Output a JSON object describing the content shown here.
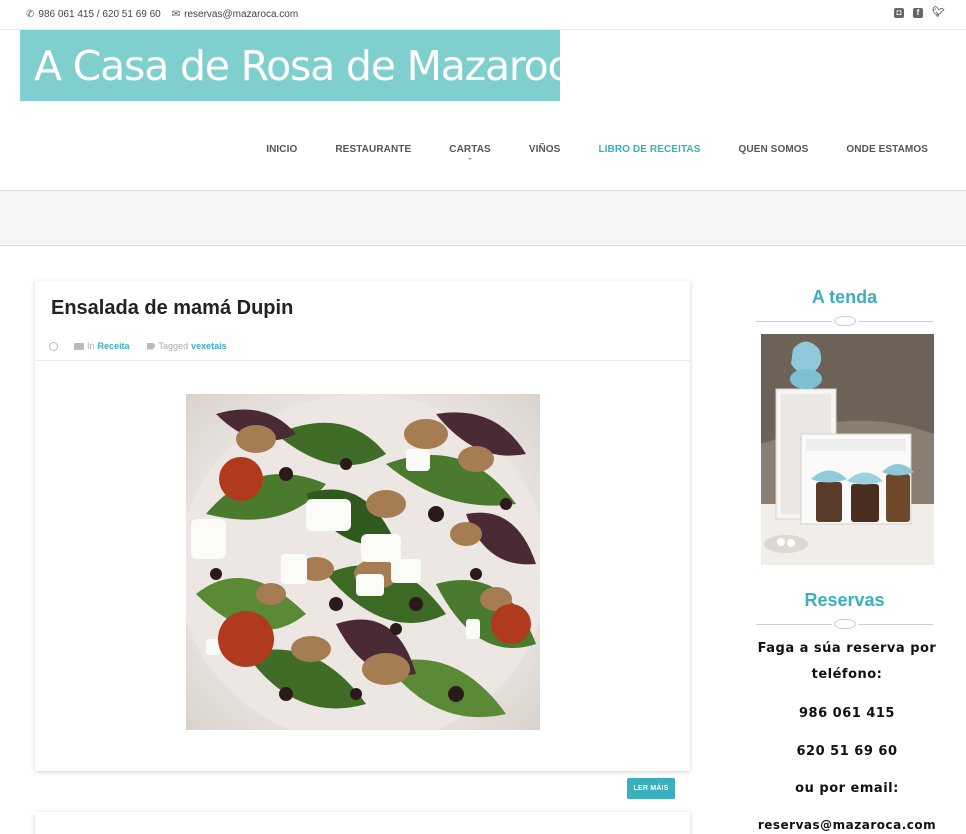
{
  "topbar": {
    "phone": "986 061 415 / 620 51 69 60",
    "email": "reservas@mazaroca.com",
    "social": [
      "instagram-icon",
      "facebook-icon",
      "twitter-icon"
    ]
  },
  "logo": {
    "text": "A Casa de Rosa de Mazaroca",
    "bg_color": "#7ecfce"
  },
  "nav": {
    "items": [
      {
        "label": "INICIO"
      },
      {
        "label": "RESTAURANTE"
      },
      {
        "label": "CARTAS"
      },
      {
        "label": "VIÑOS"
      },
      {
        "label": "LIBRO DE RECEITAS"
      },
      {
        "label": "QUEN SOMOS"
      },
      {
        "label": "ONDE ESTAMOS"
      }
    ],
    "active": "LIBRO DE RECEITAS",
    "accent_color": "#3ab0bd"
  },
  "post": {
    "title": "Ensalada de mamá Dupin",
    "in_label": "In",
    "category": "Receita",
    "tagged_label": "Tagged",
    "tag": "vexetais",
    "read_more": "LER MÁIS"
  },
  "sidebar": {
    "shop_title": "A tenda",
    "reservas_title": "Reservas",
    "reservas_intro": "Faga a súa reserva por teléfono:",
    "phone1": "986 061 415",
    "phone2": "620 51 69 60",
    "email_intro": "ou por email:",
    "email": "reservas@mazaroca.com"
  }
}
